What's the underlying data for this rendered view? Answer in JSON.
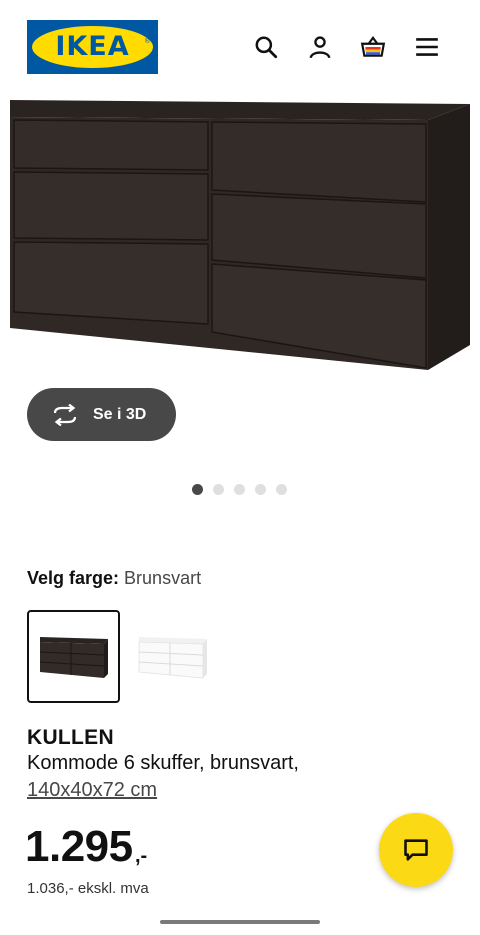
{
  "header": {
    "logo_text": "IKEA",
    "logo_reg": "®",
    "icons": [
      "search-icon",
      "profile-icon",
      "basket-icon",
      "menu-icon"
    ]
  },
  "hero": {
    "image_description_icon": "dresser-image",
    "view3d_label": "Se i 3D",
    "carousel_total": 5,
    "carousel_active": 1
  },
  "color": {
    "label": "Velg farge:",
    "value": "Brunsvart",
    "swatches": [
      "brunsvart",
      "hvit"
    ]
  },
  "product": {
    "name": "KULLEN",
    "description": "Kommode 6 skuffer, brunsvart,",
    "dimensions": "140x40x72 cm"
  },
  "price": {
    "main": "1.295",
    "suffix": ",-",
    "excl_vat": "1.036,- ekskl. mva"
  },
  "colors": {
    "brand_blue": "#0058a3",
    "brand_yellow": "#ffdb00",
    "button_dark": "#484848",
    "chat_yellow": "#fbd914"
  }
}
